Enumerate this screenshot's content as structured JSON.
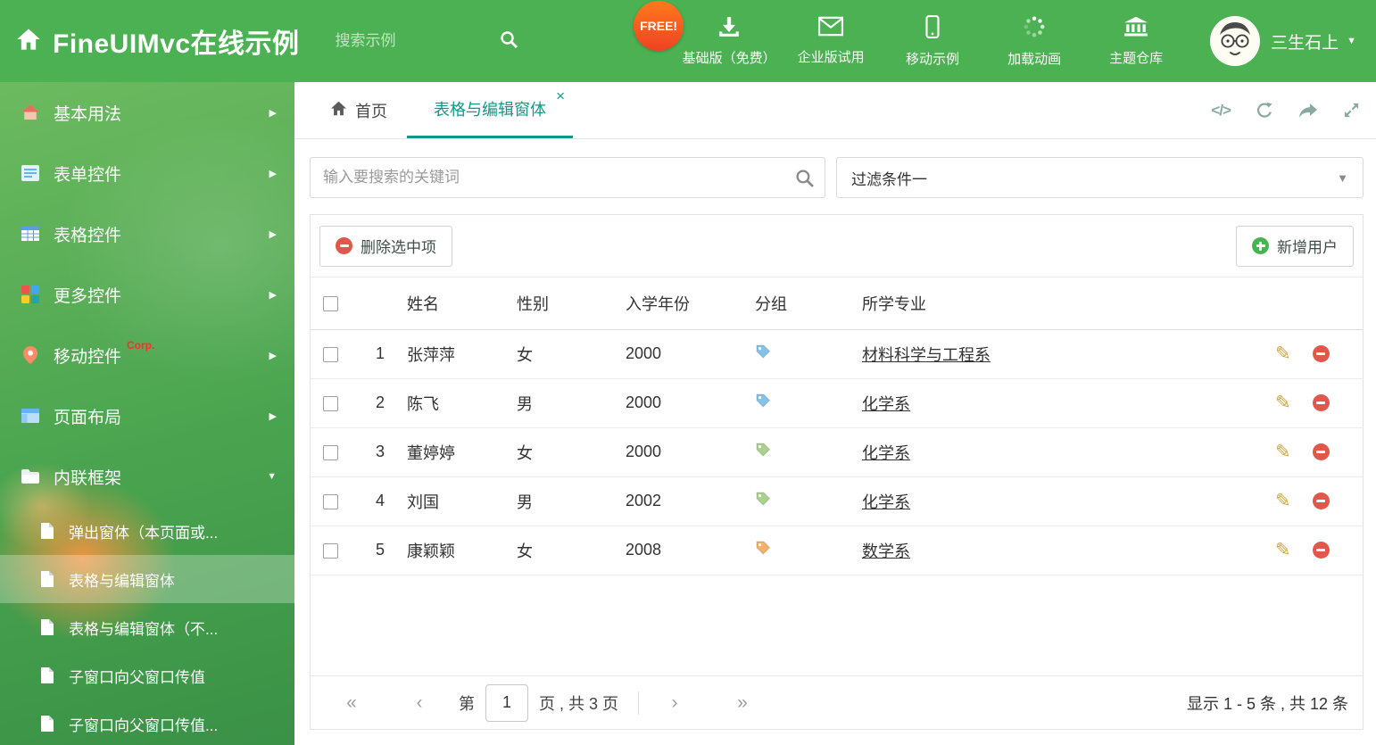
{
  "colors": {
    "header_green": "#4cb152",
    "accent_teal": "#12988a",
    "delete_red": "#e2574c",
    "add_green": "#46b450",
    "corp_red": "#ff2d2d"
  },
  "icons": {
    "chevron_right": "▶",
    "chevron_down": "▼",
    "caret_down": "▼",
    "close": "×",
    "pencil": "✎",
    "code": "</>",
    "first": "«",
    "prev": "‹",
    "next": "›",
    "last": "»"
  },
  "header": {
    "title": "FineUIMvc在线示例",
    "search_placeholder": "搜索示例",
    "free_badge": "FREE!",
    "nav_items": [
      {
        "label": "基础版（免费）",
        "icon": "download-icon"
      },
      {
        "label": "企业版试用",
        "icon": "envelope-icon"
      },
      {
        "label": "移动示例",
        "icon": "mobile-icon"
      },
      {
        "label": "加载动画",
        "icon": "spinner-icon"
      },
      {
        "label": "主题仓库",
        "icon": "bank-icon"
      }
    ],
    "username": "三生石上"
  },
  "sidebar": {
    "items": [
      {
        "label": "基本用法"
      },
      {
        "label": "表单控件"
      },
      {
        "label": "表格控件"
      },
      {
        "label": "更多控件"
      },
      {
        "label": "移动控件",
        "badge": "Corp."
      },
      {
        "label": "页面布局"
      },
      {
        "label": "内联框架"
      }
    ],
    "subitems": [
      {
        "label": "弹出窗体（本页面或..."
      },
      {
        "label": "表格与编辑窗体"
      },
      {
        "label": "表格与编辑窗体（不..."
      },
      {
        "label": "子窗口向父窗口传值"
      },
      {
        "label": "子窗口向父窗口传值..."
      }
    ]
  },
  "tabs": {
    "home_label": "首页",
    "active_label": "表格与编辑窗体"
  },
  "filter": {
    "search_placeholder": "输入要搜索的关键词",
    "selected_filter": "过滤条件一"
  },
  "toolbar": {
    "delete_label": "删除选中项",
    "add_label": "新增用户"
  },
  "table": {
    "columns": {
      "name": "姓名",
      "gender": "性别",
      "year": "入学年份",
      "group": "分组",
      "major": "所学专业"
    },
    "rows": [
      {
        "num": "1",
        "name": "张萍萍",
        "gender": "女",
        "year": "2000",
        "tag_color": "#85c1e9",
        "major": "材料科学与工程系"
      },
      {
        "num": "2",
        "name": "陈飞",
        "gender": "男",
        "year": "2000",
        "tag_color": "#85c1e9",
        "major": "化学系"
      },
      {
        "num": "3",
        "name": "董婷婷",
        "gender": "女",
        "year": "2000",
        "tag_color": "#a9d18e",
        "major": "化学系"
      },
      {
        "num": "4",
        "name": "刘国",
        "gender": "男",
        "year": "2002",
        "tag_color": "#a9d18e",
        "major": "化学系"
      },
      {
        "num": "5",
        "name": "康颖颖",
        "gender": "女",
        "year": "2008",
        "tag_color": "#f5b06c",
        "major": "数学系"
      }
    ]
  },
  "pagination": {
    "page_label_prefix": "第",
    "current_page": "1",
    "page_label_suffix": "页 , 共 3 页",
    "summary": "显示 1 - 5 条 , 共 12 条"
  }
}
